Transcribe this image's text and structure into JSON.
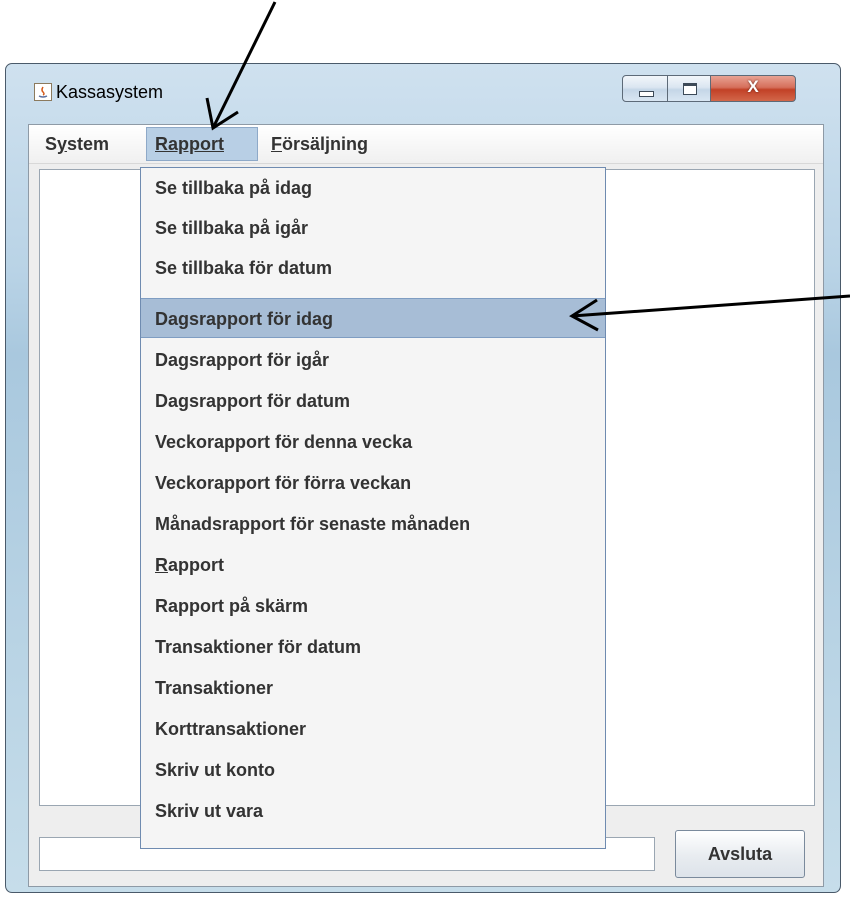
{
  "window": {
    "title": "Kassasystem",
    "close_glyph": "X"
  },
  "menubar": {
    "system": {
      "mnemonic": "y",
      "pre": "S",
      "post": "stem"
    },
    "rapport": {
      "mnemonic": "R",
      "pre": "",
      "post": "apport"
    },
    "forsaljning": {
      "mnemonic": "F",
      "pre": "",
      "post": "örsäljning"
    }
  },
  "rapport_menu": {
    "highlighted_index": 3,
    "items": [
      "Se tillbaka på idag",
      "Se tillbaka på igår",
      "Se tillbaka för datum",
      "Dagsrapport för idag",
      "Dagsrapport för igår",
      "Dagsrapport för datum",
      "Veckorapport för denna vecka",
      "Veckorapport för förra veckan",
      "Månadsrapport för senaste månaden",
      "Rapport",
      "Rapport på skärm",
      "Transaktioner för datum",
      "Transaktioner",
      "Korttransaktioner",
      "Skriv ut konto",
      "Skriv ut vara"
    ],
    "rapport_item": {
      "mnemonic": "R",
      "post": "apport"
    }
  },
  "bottom": {
    "input_value": "",
    "avsluta_label": "Avsluta"
  },
  "colors": {
    "menu_highlight": "#a7bdd6",
    "close_button": "#c24127"
  }
}
